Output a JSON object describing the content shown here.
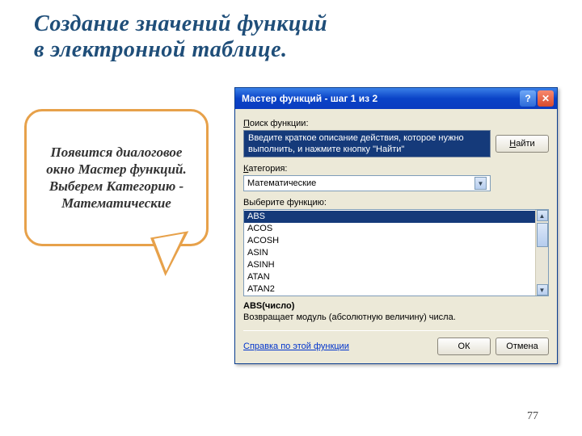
{
  "slide": {
    "title_line1": "Создание значений функций",
    "title_line2": "в электронной таблице.",
    "page_number": "77"
  },
  "callout": {
    "text": "Появится диалоговое окно Мастер функций. Выберем Категорию - Математические"
  },
  "dialog": {
    "title": "Мастер функций - шаг 1 из 2",
    "help_icon": "?",
    "close_icon": "✕",
    "search_label": "Поиск функции:",
    "search_text": "Введите краткое описание действия, которое нужно выполнить, и нажмите кнопку \"Найти\"",
    "find_button": "Найти",
    "category_label": "Категория:",
    "category_value": "Математические",
    "select_label": "Выберите функцию:",
    "functions": [
      "ABS",
      "ACOS",
      "ACOSH",
      "ASIN",
      "ASINH",
      "ATAN",
      "ATAN2"
    ],
    "signature": "ABS(число)",
    "description": "Возвращает модуль (абсолютную величину) числа.",
    "help_link": "Справка по этой функции",
    "ok_button": "ОК",
    "cancel_button": "Отмена"
  }
}
